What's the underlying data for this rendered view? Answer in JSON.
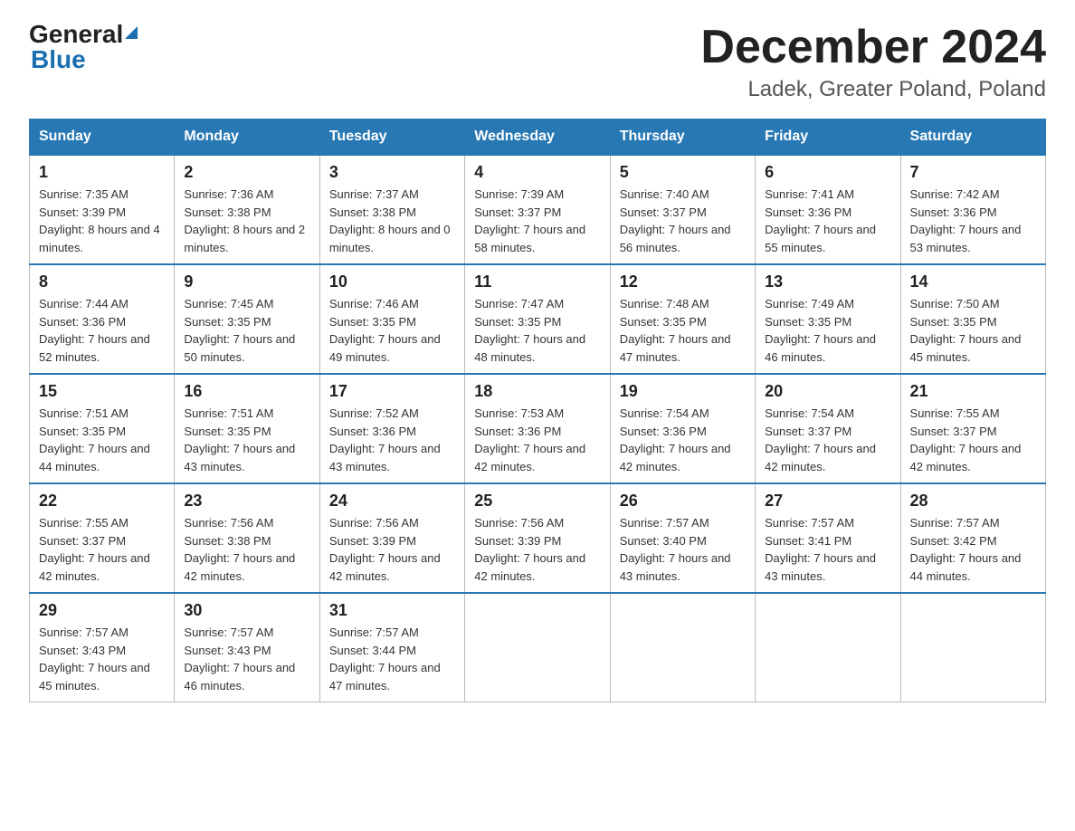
{
  "header": {
    "logo_general": "General",
    "logo_blue": "Blue",
    "month_title": "December 2024",
    "location": "Ladek, Greater Poland, Poland"
  },
  "weekdays": [
    "Sunday",
    "Monday",
    "Tuesday",
    "Wednesday",
    "Thursday",
    "Friday",
    "Saturday"
  ],
  "weeks": [
    [
      {
        "day": "1",
        "sunrise": "7:35 AM",
        "sunset": "3:39 PM",
        "daylight": "8 hours and 4 minutes."
      },
      {
        "day": "2",
        "sunrise": "7:36 AM",
        "sunset": "3:38 PM",
        "daylight": "8 hours and 2 minutes."
      },
      {
        "day": "3",
        "sunrise": "7:37 AM",
        "sunset": "3:38 PM",
        "daylight": "8 hours and 0 minutes."
      },
      {
        "day": "4",
        "sunrise": "7:39 AM",
        "sunset": "3:37 PM",
        "daylight": "7 hours and 58 minutes."
      },
      {
        "day": "5",
        "sunrise": "7:40 AM",
        "sunset": "3:37 PM",
        "daylight": "7 hours and 56 minutes."
      },
      {
        "day": "6",
        "sunrise": "7:41 AM",
        "sunset": "3:36 PM",
        "daylight": "7 hours and 55 minutes."
      },
      {
        "day": "7",
        "sunrise": "7:42 AM",
        "sunset": "3:36 PM",
        "daylight": "7 hours and 53 minutes."
      }
    ],
    [
      {
        "day": "8",
        "sunrise": "7:44 AM",
        "sunset": "3:36 PM",
        "daylight": "7 hours and 52 minutes."
      },
      {
        "day": "9",
        "sunrise": "7:45 AM",
        "sunset": "3:35 PM",
        "daylight": "7 hours and 50 minutes."
      },
      {
        "day": "10",
        "sunrise": "7:46 AM",
        "sunset": "3:35 PM",
        "daylight": "7 hours and 49 minutes."
      },
      {
        "day": "11",
        "sunrise": "7:47 AM",
        "sunset": "3:35 PM",
        "daylight": "7 hours and 48 minutes."
      },
      {
        "day": "12",
        "sunrise": "7:48 AM",
        "sunset": "3:35 PM",
        "daylight": "7 hours and 47 minutes."
      },
      {
        "day": "13",
        "sunrise": "7:49 AM",
        "sunset": "3:35 PM",
        "daylight": "7 hours and 46 minutes."
      },
      {
        "day": "14",
        "sunrise": "7:50 AM",
        "sunset": "3:35 PM",
        "daylight": "7 hours and 45 minutes."
      }
    ],
    [
      {
        "day": "15",
        "sunrise": "7:51 AM",
        "sunset": "3:35 PM",
        "daylight": "7 hours and 44 minutes."
      },
      {
        "day": "16",
        "sunrise": "7:51 AM",
        "sunset": "3:35 PM",
        "daylight": "7 hours and 43 minutes."
      },
      {
        "day": "17",
        "sunrise": "7:52 AM",
        "sunset": "3:36 PM",
        "daylight": "7 hours and 43 minutes."
      },
      {
        "day": "18",
        "sunrise": "7:53 AM",
        "sunset": "3:36 PM",
        "daylight": "7 hours and 42 minutes."
      },
      {
        "day": "19",
        "sunrise": "7:54 AM",
        "sunset": "3:36 PM",
        "daylight": "7 hours and 42 minutes."
      },
      {
        "day": "20",
        "sunrise": "7:54 AM",
        "sunset": "3:37 PM",
        "daylight": "7 hours and 42 minutes."
      },
      {
        "day": "21",
        "sunrise": "7:55 AM",
        "sunset": "3:37 PM",
        "daylight": "7 hours and 42 minutes."
      }
    ],
    [
      {
        "day": "22",
        "sunrise": "7:55 AM",
        "sunset": "3:37 PM",
        "daylight": "7 hours and 42 minutes."
      },
      {
        "day": "23",
        "sunrise": "7:56 AM",
        "sunset": "3:38 PM",
        "daylight": "7 hours and 42 minutes."
      },
      {
        "day": "24",
        "sunrise": "7:56 AM",
        "sunset": "3:39 PM",
        "daylight": "7 hours and 42 minutes."
      },
      {
        "day": "25",
        "sunrise": "7:56 AM",
        "sunset": "3:39 PM",
        "daylight": "7 hours and 42 minutes."
      },
      {
        "day": "26",
        "sunrise": "7:57 AM",
        "sunset": "3:40 PM",
        "daylight": "7 hours and 43 minutes."
      },
      {
        "day": "27",
        "sunrise": "7:57 AM",
        "sunset": "3:41 PM",
        "daylight": "7 hours and 43 minutes."
      },
      {
        "day": "28",
        "sunrise": "7:57 AM",
        "sunset": "3:42 PM",
        "daylight": "7 hours and 44 minutes."
      }
    ],
    [
      {
        "day": "29",
        "sunrise": "7:57 AM",
        "sunset": "3:43 PM",
        "daylight": "7 hours and 45 minutes."
      },
      {
        "day": "30",
        "sunrise": "7:57 AM",
        "sunset": "3:43 PM",
        "daylight": "7 hours and 46 minutes."
      },
      {
        "day": "31",
        "sunrise": "7:57 AM",
        "sunset": "3:44 PM",
        "daylight": "7 hours and 47 minutes."
      },
      null,
      null,
      null,
      null
    ]
  ]
}
